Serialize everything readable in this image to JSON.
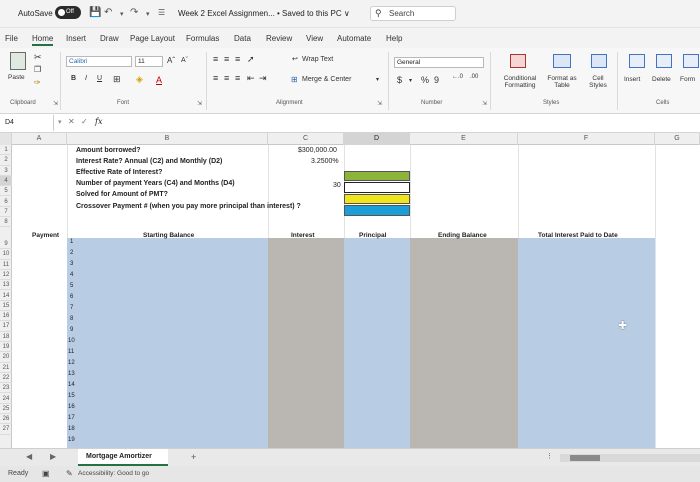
{
  "titlebar": {
    "autosave": "AutoSave",
    "toggle": "Off",
    "document": "Week 2 Excel Assignmen... • Saved to this PC ∨",
    "search_placeholder": "Search"
  },
  "menu": [
    "File",
    "Home",
    "Insert",
    "Draw",
    "Page Layout",
    "Formulas",
    "Data",
    "Review",
    "View",
    "Automate",
    "Help"
  ],
  "ribbon": {
    "paste": "Paste",
    "font_name": "Calibri",
    "font_size": "11",
    "wrap_text": "Wrap Text",
    "merge_center": "Merge & Center",
    "number_format": "General",
    "conditional_formatting": "Conditional Formatting",
    "format_as_table": "Format as Table",
    "cell_styles": "Cell Styles",
    "insert": "Insert",
    "delete": "Delete",
    "format": "Form",
    "groups": {
      "clipboard": "Clipboard",
      "font": "Font",
      "alignment": "Alignment",
      "number": "Number",
      "styles": "Styles",
      "cells": "Cells"
    }
  },
  "formula_bar": {
    "name_box": "D4",
    "fx": "fx"
  },
  "columns": [
    "A",
    "B",
    "C",
    "D",
    "E",
    "F",
    "G"
  ],
  "rows": [
    "1",
    "2",
    "3",
    "4",
    "5",
    "6",
    "7",
    "8",
    "9",
    "10",
    "11",
    "12",
    "13",
    "14",
    "15",
    "16",
    "17",
    "18",
    "19",
    "20",
    "21",
    "22",
    "23",
    "24",
    "25",
    "26",
    "27"
  ],
  "inputs": {
    "amount_label": "Amount borrowed?",
    "rate_label": "Interest Rate? Annual (C2) and Monthly (D2)",
    "effective_label": "Effective Rate of Interest?",
    "payments_label": "Number of payment Years (C4) and Months (D4)",
    "pmt_label": "Solved for Amount of PMT?",
    "crossover_label": "Crossover Payment # (when you pay more principal than interest) ?",
    "amount_value": "$300,000.00",
    "rate_value": "3.2500%",
    "years_value": "30"
  },
  "table_headers": {
    "payment": "Payment",
    "starting_balance": "Starting Balance",
    "interest": "Interest",
    "principal": "Principal",
    "ending_balance": "Ending Balance",
    "total_interest": "Total Interest Paid to Date"
  },
  "payment_numbers": [
    "1",
    "2",
    "3",
    "4",
    "5",
    "6",
    "7",
    "8",
    "9",
    "10",
    "11",
    "12",
    "13",
    "14",
    "15",
    "16",
    "17",
    "18",
    "19"
  ],
  "sheet_tab": "Mortgage Amortizer",
  "status": {
    "ready": "Ready",
    "accessibility": "Accessibility: Good to go"
  },
  "colors": {
    "blue_fill": "#b8cce4",
    "gray_fill": "#bab6b2",
    "green_input": "#8db43a",
    "yellow_input": "#f0e51c",
    "cyan_input": "#1b9fd6",
    "accent": "#217346"
  }
}
